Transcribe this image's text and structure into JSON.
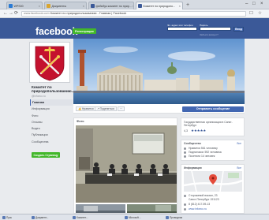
{
  "browser": {
    "tabs": [
      {
        "label": "WPS00",
        "active": false
      },
      {
        "label": "Документы",
        "active": false
      },
      {
        "label": "фейсбук комитет по прир...",
        "active": false
      },
      {
        "label": "Комитет по природопо...",
        "active": true
      }
    ],
    "new_tab": "+",
    "window_buttons": [
      "–",
      "□",
      "×"
    ],
    "nav": {
      "back": "←",
      "forward": "→",
      "reload": "⟳"
    },
    "url_domain": "www.facebook.com",
    "url_title": "Комитет по природопользованию - Главная | Facebook"
  },
  "fb_header": {
    "logo": "facebook",
    "register_label": "Регистрация",
    "email_label": "Эл. адрес или телефон",
    "password_label": "Пароль",
    "login_button": "Вход",
    "forgot": "Забыли аккаунт?"
  },
  "left": {
    "page_name": "Комитет по природопользованию...",
    "handle": "@infoeco.ru",
    "nav": [
      {
        "label": "Главная",
        "active": true
      },
      {
        "label": "Информация",
        "active": false
      },
      {
        "label": "Фото",
        "active": false
      },
      {
        "label": "Отзывы",
        "active": false
      },
      {
        "label": "Видео",
        "active": false
      },
      {
        "label": "Публикации",
        "active": false
      },
      {
        "label": "Сообщества",
        "active": false
      }
    ],
    "create_page": "Создать Страницу"
  },
  "page_bar": {
    "like": "👍 Нравится",
    "share": "↗ Поделиться",
    "more": "···",
    "send_message": "Отправить сообщение"
  },
  "photos": {
    "title": "Фото"
  },
  "about_card": {
    "text": "Государственная организация в Санкт-Петербург",
    "stars": "★★★★★",
    "rating": "4,3"
  },
  "community": {
    "title": "Сообщество",
    "more": "Все",
    "lines": [
      "Нравится 561 человеку",
      "Подписчики: 592 человека",
      "Посетили 14 человек"
    ]
  },
  "info": {
    "title": "Информация",
    "more": "Все",
    "lines": [
      "Сторожевой вокзал, 23",
      "Санкт-Петербург 191123",
      "8 (812) 417-59-13",
      "www.infoeco.ru"
    ]
  },
  "colors": {
    "fb_blue": "#3b5998",
    "button_blue": "#4267b2",
    "green": "#42b72a"
  },
  "taskbar": [
    {
      "label": "Пуск"
    },
    {
      "label": "Документ..."
    },
    {
      "label": "Комитет..."
    },
    {
      "label": "Microsoft..."
    },
    {
      "label": "Проводник"
    }
  ]
}
